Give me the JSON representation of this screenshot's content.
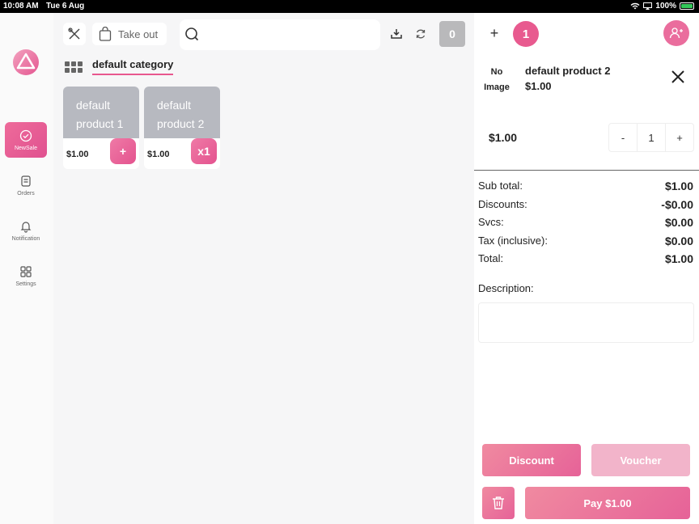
{
  "status_bar": {
    "time": "10:08 AM",
    "date": "Tue 6 Aug",
    "battery": "100%"
  },
  "sidebar": {
    "items": [
      {
        "label": "NewSale",
        "icon": "check-circle-icon",
        "active": true
      },
      {
        "label": "Orders",
        "icon": "receipt-icon",
        "active": false
      },
      {
        "label": "Notification",
        "icon": "bell-icon",
        "active": false
      },
      {
        "label": "Settings",
        "icon": "grid-squares-icon",
        "active": false
      }
    ]
  },
  "toolbar": {
    "order_type": "Take out",
    "count": "0",
    "icons": [
      "tools-icon",
      "bag-icon",
      "search-icon",
      "download-icon",
      "refresh-icon"
    ]
  },
  "category": {
    "name": "default category"
  },
  "products": [
    {
      "name": "default product 1",
      "price": "$1.00",
      "action": "+"
    },
    {
      "name": "default product 2",
      "price": "$1.00",
      "action": "x1"
    }
  ],
  "cart": {
    "add_label": "+",
    "customer_count": "1",
    "item": {
      "image_placeholder": "No Image",
      "name": "default product 2",
      "price": "$1.00"
    },
    "line_price": "$1.00",
    "stepper": {
      "minus": "-",
      "qty": "1",
      "plus": "+"
    },
    "summary": [
      {
        "label": "Sub total:",
        "value": "$1.00"
      },
      {
        "label": "Discounts:",
        "value": "-$0.00"
      },
      {
        "label": "Svcs:",
        "value": "$0.00"
      },
      {
        "label": "Tax (inclusive):",
        "value": "$0.00"
      },
      {
        "label": "Total:",
        "value": "$1.00"
      }
    ],
    "description_label": "Description:",
    "description_value": "",
    "discount_label": "Discount",
    "voucher_label": "Voucher",
    "pay_label": "Pay $1.00"
  },
  "colors": {
    "accent": "#e8578e",
    "accent_light": "#f2b4ca",
    "product_thumb": "#b7b9c0"
  }
}
